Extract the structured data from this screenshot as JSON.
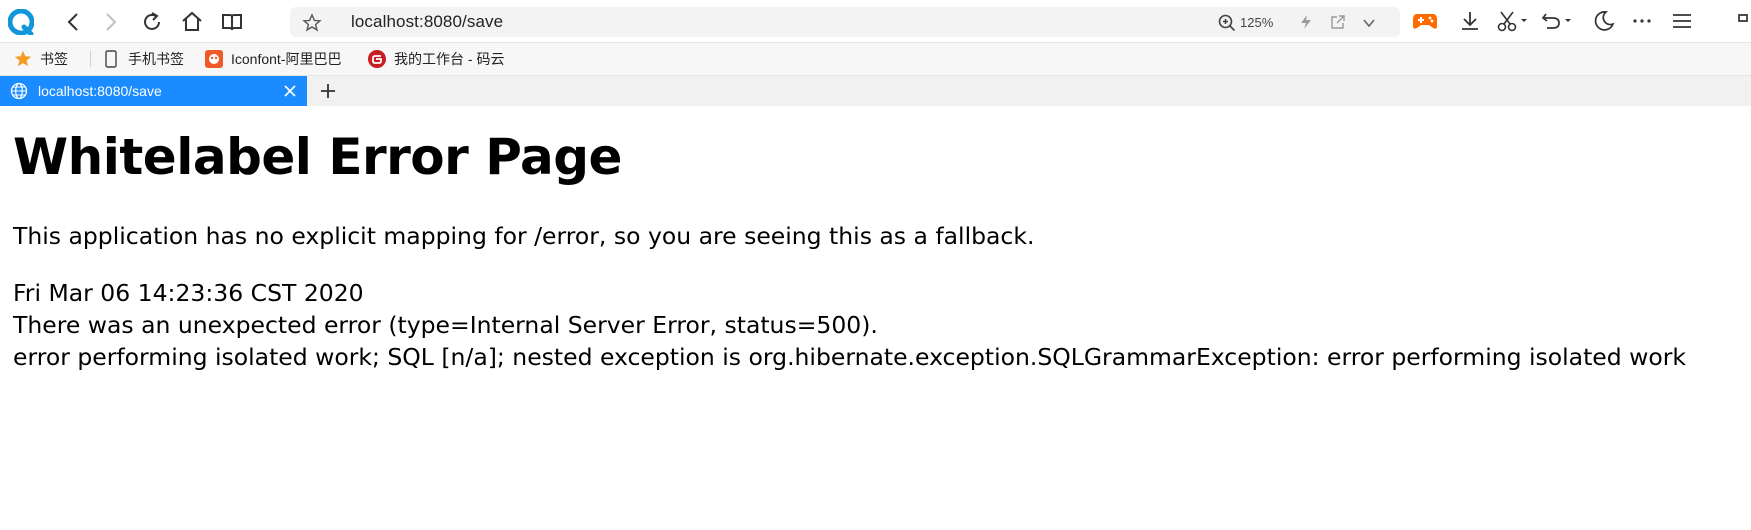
{
  "browser": {
    "address": "localhost:8080/save",
    "zoom": "125%",
    "icons": [
      "browser-logo-icon",
      "back-icon",
      "forward-icon",
      "reload-icon",
      "home-icon",
      "reader-icon",
      "star-icon",
      "zoom-icon",
      "bolt-icon",
      "share-icon",
      "chevron-down-icon",
      "game-icon",
      "download-icon",
      "scissors-icon",
      "undo-icon",
      "moon-icon",
      "more-icon",
      "menu-icon"
    ]
  },
  "bookmarks": [
    {
      "label": "书签",
      "icon": "star-icon"
    },
    {
      "label": "手机书签",
      "icon": "phone-icon"
    },
    {
      "label": "Iconfont-阿里巴巴",
      "icon": "iconfont-icon"
    },
    {
      "label": "我的工作台 - 码云",
      "icon": "gitee-icon"
    }
  ],
  "tabs": [
    {
      "title": "localhost:8080/save",
      "active": true
    }
  ],
  "page": {
    "heading": "Whitelabel Error Page",
    "message": "This application has no explicit mapping for /error, so you are seeing this as a fallback.",
    "timestamp": "Fri Mar 06 14:23:36 CST 2020",
    "error_line": "There was an unexpected error (type=Internal Server Error, status=500).",
    "details": "error performing isolated work; SQL [n/a]; nested exception is org.hibernate.exception.SQLGrammarException: error performing isolated work"
  },
  "colors": {
    "tab_active": "#1a8cff",
    "logo": "#1296db",
    "game_icon": "#ff6a00",
    "iconfont": "#f05a28",
    "gitee": "#c71d23"
  }
}
